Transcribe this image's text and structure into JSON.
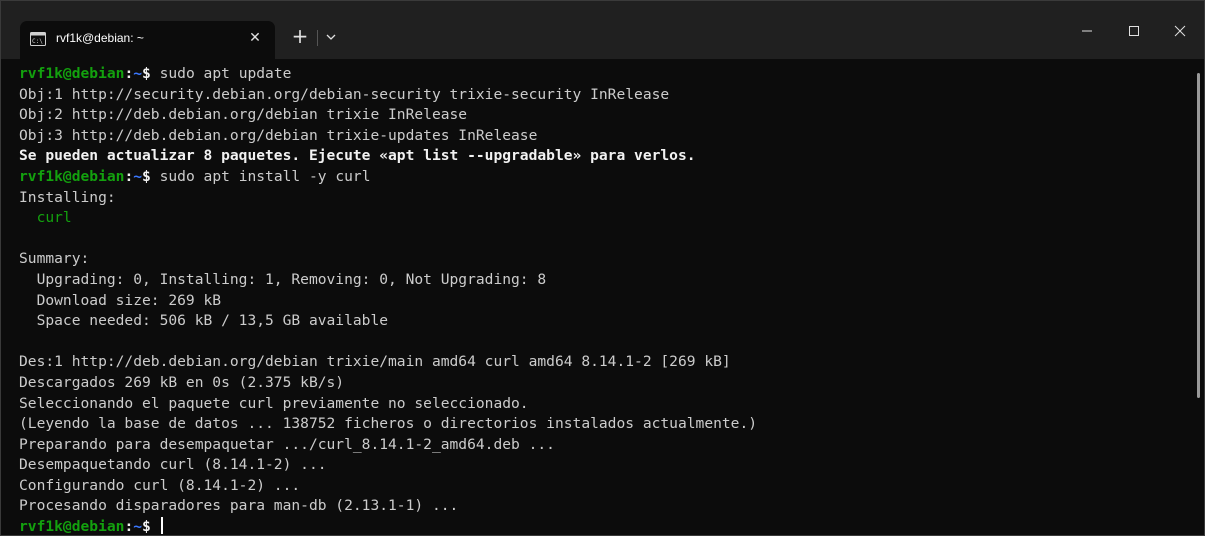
{
  "window": {
    "tab_title": "rvf1k@debian: ~",
    "tab_icon": "terminal-icon",
    "new_tab_label": "+",
    "close_tab_label": "✕"
  },
  "colors": {
    "background": "#0c0c0c",
    "titlebar": "#202020",
    "user_host": "#13a10e",
    "path": "#3b78ff",
    "text": "#cccccc"
  },
  "terminal": {
    "prompt_user": "rvf1k@debian",
    "prompt_path": "~",
    "prompt_symbol": "$",
    "lines": [
      {
        "type": "prompt",
        "cmd": " sudo apt update"
      },
      {
        "type": "text",
        "text": "Obj:1 http://security.debian.org/debian-security trixie-security InRelease"
      },
      {
        "type": "text",
        "text": "Obj:2 http://deb.debian.org/debian trixie InRelease"
      },
      {
        "type": "text",
        "text": "Obj:3 http://deb.debian.org/debian trixie-updates InRelease"
      },
      {
        "type": "bold",
        "text": "Se pueden actualizar 8 paquetes. Ejecute «apt list --upgradable» para verlos."
      },
      {
        "type": "prompt",
        "cmd": " sudo apt install -y curl"
      },
      {
        "type": "text",
        "text": "Installing:"
      },
      {
        "type": "green",
        "text": "  curl"
      },
      {
        "type": "text",
        "text": ""
      },
      {
        "type": "text",
        "text": "Summary:"
      },
      {
        "type": "text",
        "text": "  Upgrading: 0, Installing: 1, Removing: 0, Not Upgrading: 8"
      },
      {
        "type": "text",
        "text": "  Download size: 269 kB"
      },
      {
        "type": "text",
        "text": "  Space needed: 506 kB / 13,5 GB available"
      },
      {
        "type": "text",
        "text": ""
      },
      {
        "type": "text",
        "text": "Des:1 http://deb.debian.org/debian trixie/main amd64 curl amd64 8.14.1-2 [269 kB]"
      },
      {
        "type": "text",
        "text": "Descargados 269 kB en 0s (2.375 kB/s)"
      },
      {
        "type": "text",
        "text": "Seleccionando el paquete curl previamente no seleccionado."
      },
      {
        "type": "text",
        "text": "(Leyendo la base de datos ... 138752 ficheros o directorios instalados actualmente.)"
      },
      {
        "type": "text",
        "text": "Preparando para desempaquetar .../curl_8.14.1-2_amd64.deb ..."
      },
      {
        "type": "text",
        "text": "Desempaquetando curl (8.14.1-2) ..."
      },
      {
        "type": "text",
        "text": "Configurando curl (8.14.1-2) ..."
      },
      {
        "type": "text",
        "text": "Procesando disparadores para man-db (2.13.1-1) ..."
      },
      {
        "type": "prompt",
        "cmd": " ",
        "cursor": true
      }
    ]
  }
}
